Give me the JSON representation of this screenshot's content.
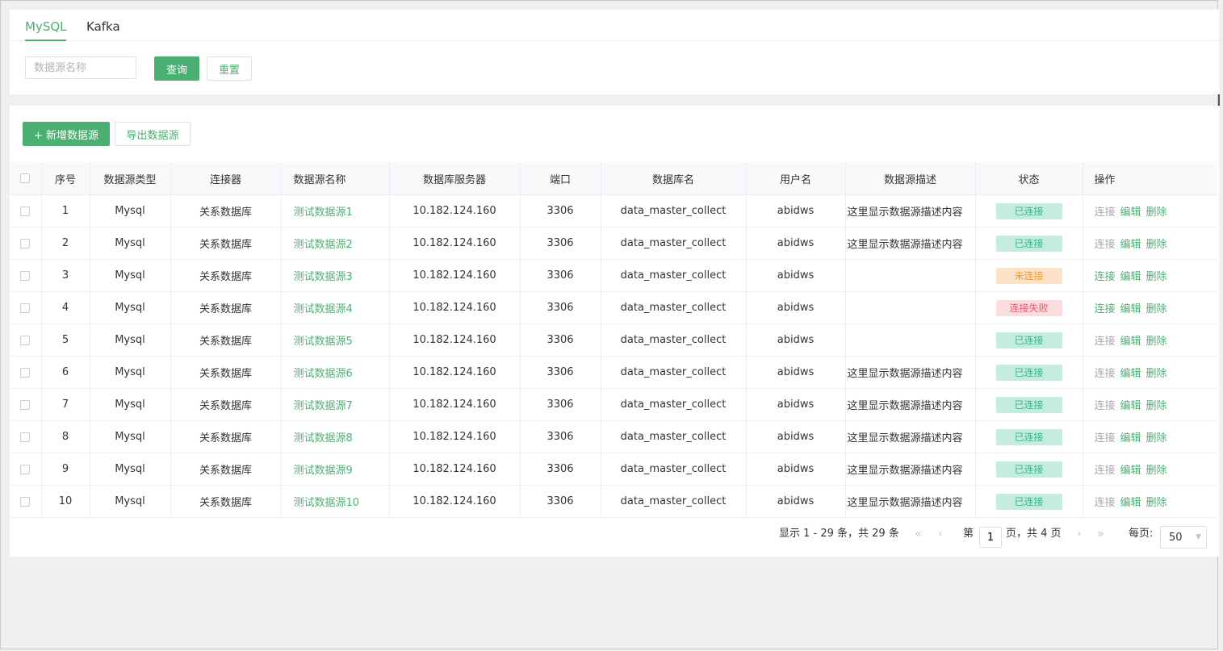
{
  "tabs": [
    {
      "label": "MySQL",
      "active": true
    },
    {
      "label": "Kafka",
      "active": false
    }
  ],
  "search": {
    "placeholder": "数据源名称",
    "query_label": "查询",
    "reset_label": "重置"
  },
  "toolbar": {
    "add_label": "+ 新增数据源",
    "export_label": "导出数据源"
  },
  "table": {
    "headers": [
      "序号",
      "数据源类型",
      "连接器",
      "数据源名称",
      "数据库服务器",
      "端口",
      "数据库名",
      "用户名",
      "数据源描述",
      "状态",
      "操作"
    ],
    "rows": [
      {
        "no": "1",
        "type": "Mysql",
        "connector": "关系数据库",
        "name": "测试数据源1",
        "server": "10.182.124.160",
        "port": "3306",
        "db": "data_master_collect",
        "user": "abidws",
        "desc": "这里显示数据源描述内容",
        "status": "已连接",
        "status_kind": "ok"
      },
      {
        "no": "2",
        "type": "Mysql",
        "connector": "关系数据库",
        "name": "测试数据源2",
        "server": "10.182.124.160",
        "port": "3306",
        "db": "data_master_collect",
        "user": "abidws",
        "desc": "这里显示数据源描述内容",
        "status": "已连接",
        "status_kind": "ok"
      },
      {
        "no": "3",
        "type": "Mysql",
        "connector": "关系数据库",
        "name": "测试数据源3",
        "server": "10.182.124.160",
        "port": "3306",
        "db": "data_master_collect",
        "user": "abidws",
        "desc": "",
        "status": "未连接",
        "status_kind": "no"
      },
      {
        "no": "4",
        "type": "Mysql",
        "connector": "关系数据库",
        "name": "测试数据源4",
        "server": "10.182.124.160",
        "port": "3306",
        "db": "data_master_collect",
        "user": "abidws",
        "desc": "",
        "status": "连接失败",
        "status_kind": "fail"
      },
      {
        "no": "5",
        "type": "Mysql",
        "connector": "关系数据库",
        "name": "测试数据源5",
        "server": "10.182.124.160",
        "port": "3306",
        "db": "data_master_collect",
        "user": "abidws",
        "desc": "",
        "status": "已连接",
        "status_kind": "ok"
      },
      {
        "no": "6",
        "type": "Mysql",
        "connector": "关系数据库",
        "name": "测试数据源6",
        "server": "10.182.124.160",
        "port": "3306",
        "db": "data_master_collect",
        "user": "abidws",
        "desc": "这里显示数据源描述内容",
        "status": "已连接",
        "status_kind": "ok"
      },
      {
        "no": "7",
        "type": "Mysql",
        "connector": "关系数据库",
        "name": "测试数据源7",
        "server": "10.182.124.160",
        "port": "3306",
        "db": "data_master_collect",
        "user": "abidws",
        "desc": "这里显示数据源描述内容",
        "status": "已连接",
        "status_kind": "ok"
      },
      {
        "no": "8",
        "type": "Mysql",
        "connector": "关系数据库",
        "name": "测试数据源8",
        "server": "10.182.124.160",
        "port": "3306",
        "db": "data_master_collect",
        "user": "abidws",
        "desc": "这里显示数据源描述内容",
        "status": "已连接",
        "status_kind": "ok"
      },
      {
        "no": "9",
        "type": "Mysql",
        "connector": "关系数据库",
        "name": "测试数据源9",
        "server": "10.182.124.160",
        "port": "3306",
        "db": "data_master_collect",
        "user": "abidws",
        "desc": "这里显示数据源描述内容",
        "status": "已连接",
        "status_kind": "ok"
      },
      {
        "no": "10",
        "type": "Mysql",
        "connector": "关系数据库",
        "name": "测试数据源10",
        "server": "10.182.124.160",
        "port": "3306",
        "db": "data_master_collect",
        "user": "abidws",
        "desc": "这里显示数据源描述内容",
        "status": "已连接",
        "status_kind": "ok"
      }
    ],
    "actions": {
      "connect": "连接",
      "edit": "编辑",
      "delete": "删除"
    }
  },
  "pagination": {
    "summary": "显示 1 - 29 条，共 29 条",
    "page_prefix": "第",
    "current_page": "1",
    "page_suffix": "页，共 4 页",
    "per_page_label": "每页:",
    "per_page_value": "50"
  },
  "colors": {
    "accent": "#4caf72",
    "status_ok_bg": "#c4ece0",
    "status_ok_text": "#3eb584",
    "status_no_bg": "#fbe2c9",
    "status_no_text": "#ec9c3a",
    "status_fail_bg": "#fbdddf",
    "status_fail_text": "#e85a6a"
  },
  "icons": {
    "first": "double-chevron-left-icon",
    "prev": "chevron-left-icon",
    "next": "chevron-right-icon",
    "last": "double-chevron-right-icon",
    "select": "caret-down-icon"
  }
}
